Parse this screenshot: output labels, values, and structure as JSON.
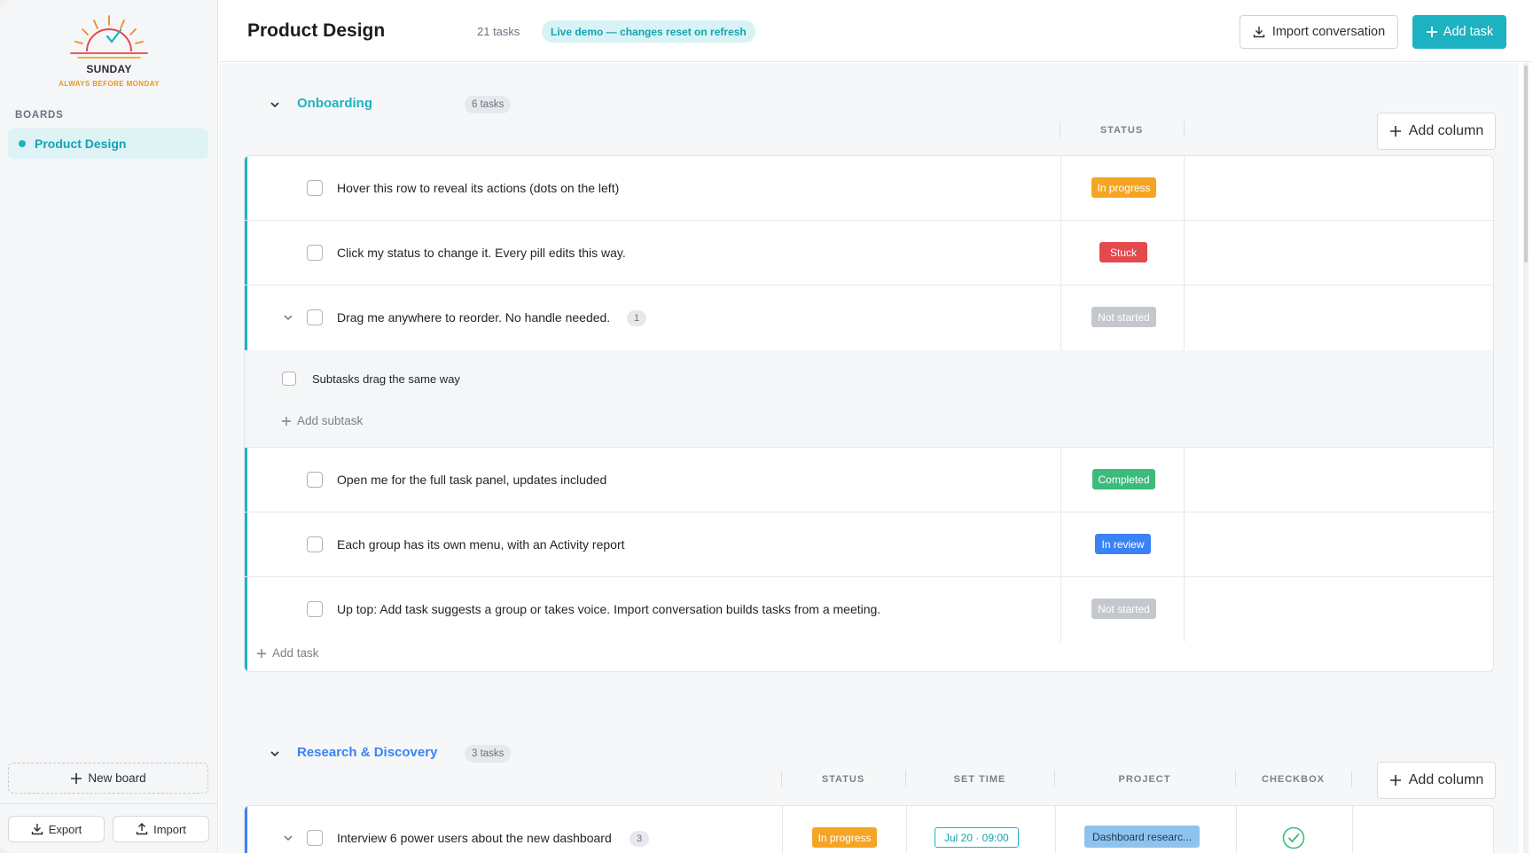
{
  "brand": {
    "name": "SUNDAY",
    "tagline": "ALWAYS BEFORE MONDAY",
    "accent": "#1db2c1",
    "sun_color": "#e8961e"
  },
  "sidebar": {
    "section_label": "BOARDS",
    "boards": [
      {
        "label": "Product Design",
        "active": true
      }
    ],
    "new_board_label": "New board",
    "export_label": "Export",
    "import_label": "Import"
  },
  "header": {
    "title": "Product Design",
    "task_count": "21 tasks",
    "demo_badge": "Live demo — changes reset on refresh",
    "import_conversation_label": "Import conversation",
    "add_task_label": "Add task"
  },
  "status_colors": {
    "In progress": "#f5a524",
    "Stuck": "#e5484d",
    "Not started": "#c4c7cc",
    "Completed": "#3dbb7c",
    "In review": "#3b82f6"
  },
  "groups": [
    {
      "title": "Onboarding",
      "color": "#1db2c1",
      "count": "6 tasks",
      "columns": [
        "STATUS"
      ],
      "add_column_label": "Add column",
      "add_task_label": "Add task",
      "tasks": [
        {
          "text": "Hover this row to reveal its actions (dots on the left)",
          "status": "In progress"
        },
        {
          "text": "Click my status to change it. Every pill edits this way.",
          "status": "Stuck"
        },
        {
          "text": "Drag me anywhere to reorder. No handle needed.",
          "status": "Not started",
          "subtask_count": "1",
          "subtasks": [
            {
              "text": "Subtasks drag the same way"
            }
          ],
          "add_subtask_label": "Add subtask"
        },
        {
          "text": "Open me for the full task panel, updates included",
          "status": "Completed"
        },
        {
          "text": "Each group has its own menu, with an Activity report",
          "status": "In review"
        },
        {
          "text": "Up top: Add task suggests a group or takes voice. Import conversation builds tasks from a meeting.",
          "status": "Not started"
        }
      ]
    },
    {
      "title": "Research & Discovery",
      "color": "#3b82f6",
      "count": "3 tasks",
      "columns": [
        "STATUS",
        "SET TIME",
        "PROJECT",
        "CHECKBOX"
      ],
      "add_column_label": "Add column",
      "tasks": [
        {
          "text": "Interview 6 power users about the new dashboard",
          "subtask_count": "3",
          "status": "In progress",
          "time": "Jul 20 · 09:00",
          "project": "Dashboard researc...",
          "checked": true
        }
      ]
    }
  ]
}
